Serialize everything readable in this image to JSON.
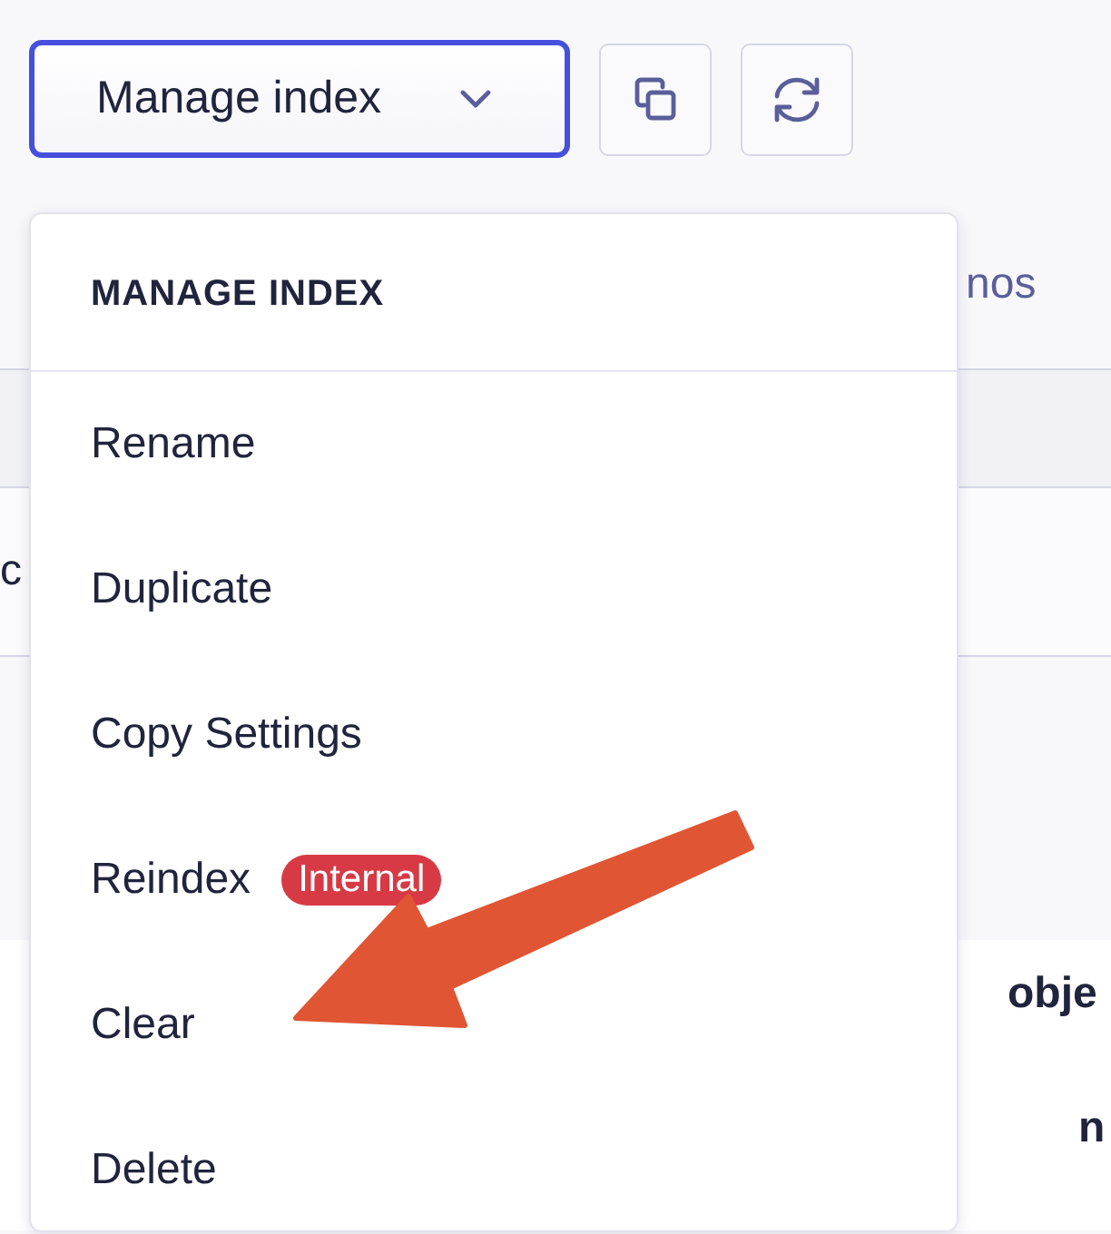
{
  "toolbar": {
    "manage_button": {
      "label": "Manage index",
      "focused": true
    }
  },
  "background": {
    "tab_fragment": "nos",
    "row_fragment": "c",
    "column_fragments": [
      "obje",
      "n"
    ]
  },
  "menu": {
    "header": "MANAGE INDEX",
    "items": [
      {
        "label": "Rename"
      },
      {
        "label": "Duplicate"
      },
      {
        "label": "Copy Settings"
      },
      {
        "label": "Reindex",
        "badge": "Internal"
      },
      {
        "label": "Clear"
      },
      {
        "label": "Delete"
      }
    ]
  }
}
